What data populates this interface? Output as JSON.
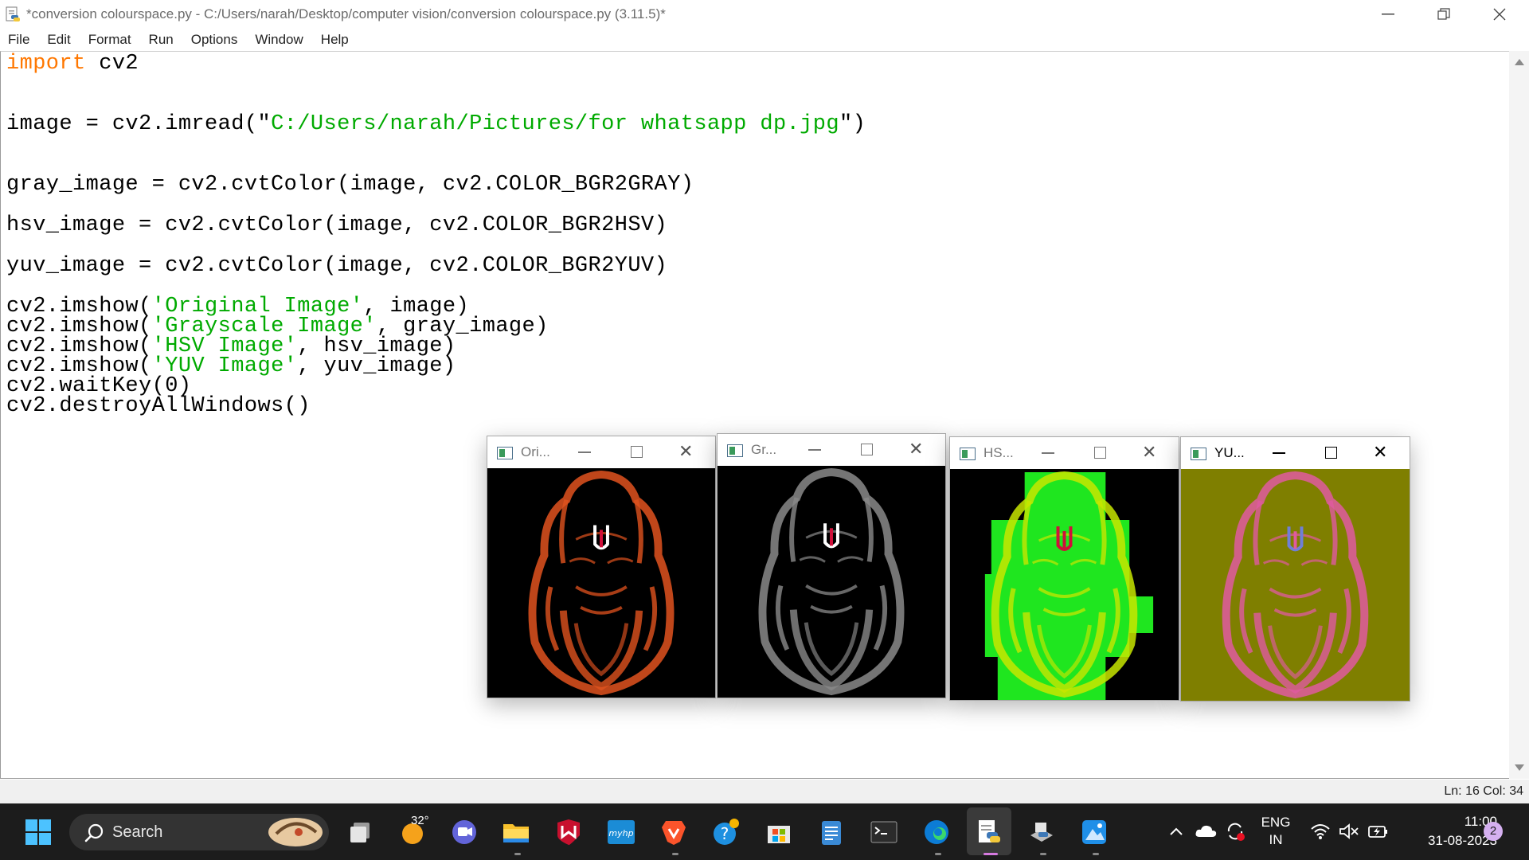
{
  "window": {
    "title": "*conversion colourspace.py - C:/Users/narah/Desktop/computer vision/conversion colourspace.py (3.11.5)*"
  },
  "menu": [
    "File",
    "Edit",
    "Format",
    "Run",
    "Options",
    "Window",
    "Help"
  ],
  "code": [
    {
      "t": "import",
      "c": "kw"
    },
    {
      "t": " cv2"
    },
    {
      "t": "image = cv2.imread(\""
    },
    {
      "t": "C:/Users/narah/Pictures/for whatsapp dp.jpg",
      "c": "str"
    },
    {
      "t": "\")"
    },
    {
      "t": "gray_image = cv2.cvtColor(image, cv2.COLOR_BGR2GRAY)"
    },
    {
      "t": "hsv_image = cv2.cvtColor(image, cv2.COLOR_BGR2HSV)"
    },
    {
      "t": "yuv_image = cv2.cvtColor(image, cv2.COLOR_BGR2YUV)"
    },
    {
      "t": "cv2.imshow("
    },
    {
      "t": "'Original Image'",
      "c": "str"
    },
    {
      "t": ", image)"
    },
    {
      "t": "cv2.imshow("
    },
    {
      "t": "'Grayscale Image'",
      "c": "str"
    },
    {
      "t": ", gray_image)"
    },
    {
      "t": "cv2.imshow("
    },
    {
      "t": "'HSV Image'",
      "c": "str"
    },
    {
      "t": ", hsv_image)"
    },
    {
      "t": "cv2.imshow("
    },
    {
      "t": "'YUV Image'",
      "c": "str"
    },
    {
      "t": ", yuv_image)"
    },
    {
      "t": "cv2.waitKey(0)"
    },
    {
      "t": "cv2.destroyAllWindows()"
    }
  ],
  "status": {
    "position": "Ln: 16   Col: 34"
  },
  "image_windows": [
    {
      "title": "Ori...",
      "bg": "#000000",
      "ink": "#e0521e",
      "tilak": "#ffffff"
    },
    {
      "title": "Gr...",
      "bg": "#000000",
      "ink": "#8a8a8a",
      "tilak": "#ffffff"
    },
    {
      "title": "HS...",
      "bg": "#000000",
      "ink": "#c8e600",
      "tilak": "#d0103a"
    },
    {
      "title": "YU...",
      "bg": "#7f7f00",
      "ink": "#e05aa0",
      "tilak": "#6f7fd8"
    }
  ],
  "taskbar": {
    "search_label": "Search",
    "weather": "32°",
    "lang_top": "ENG",
    "lang_bottom": "IN",
    "time": "11:00",
    "date": "31-08-2023",
    "notifications": "2"
  },
  "colors": {
    "keyword": "#ff7700",
    "string": "#00aa00",
    "taskbar": "#1c1c1c"
  }
}
